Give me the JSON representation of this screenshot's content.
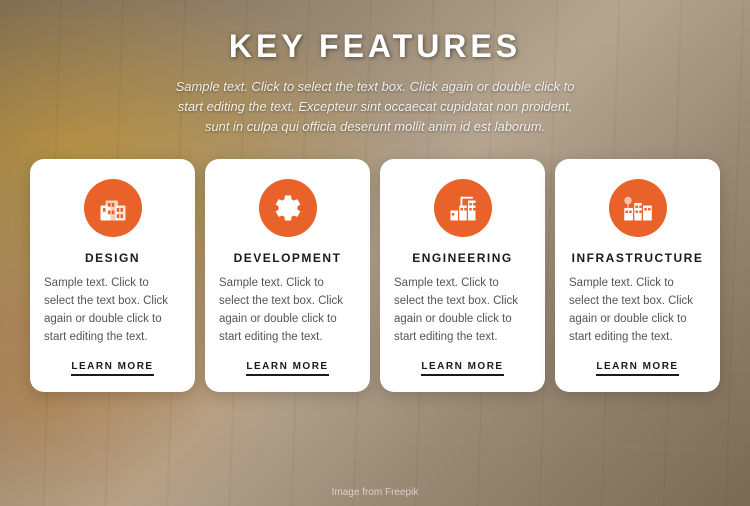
{
  "page": {
    "title": "KEY FEATURES",
    "subtitle": "Sample text. Click to select the text box. Click again or double click to start editing the text. Excepteur sint occaecat cupidatat non proident, sunt in culpa qui officia deserunt mollit anim id est laborum.",
    "image_credit": "Image from Freepik"
  },
  "cards": [
    {
      "id": "design",
      "title": "DESIGN",
      "icon": "design",
      "text": "Sample text. Click to select the text box. Click again or double click to start editing the text.",
      "link_label": "LEARN MORE"
    },
    {
      "id": "development",
      "title": "DEVELOPMENT",
      "icon": "development",
      "text": "Sample text. Click to select the text box. Click again or double click to start editing the text.",
      "link_label": "LEARN MORE"
    },
    {
      "id": "engineering",
      "title": "ENGINEERING",
      "icon": "engineering",
      "text": "Sample text. Click to select the text box. Click again or double click to start editing the text.",
      "link_label": "LEARN MORE"
    },
    {
      "id": "infrastructure",
      "title": "INFRASTRUCTURE",
      "icon": "infrastructure",
      "text": "Sample text. Click to select the text box. Click again or double click to start editing the text.",
      "link_label": "LEARN MORE"
    }
  ],
  "colors": {
    "accent": "#e8622a",
    "white": "#ffffff",
    "dark": "#1a1a1a",
    "text": "#555555"
  }
}
